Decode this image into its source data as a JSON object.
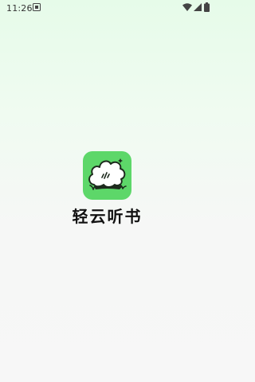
{
  "status_bar": {
    "time": "11:26",
    "notification_icon": "notification-box-icon",
    "wifi_icon": "wifi-icon",
    "signal_icon": "signal-icon",
    "battery_icon": "battery-icon"
  },
  "splash": {
    "app_icon": "cloud-logo-icon",
    "app_name": "轻云听书"
  },
  "colors": {
    "brand_green": "#5dd769",
    "text": "#111111"
  }
}
